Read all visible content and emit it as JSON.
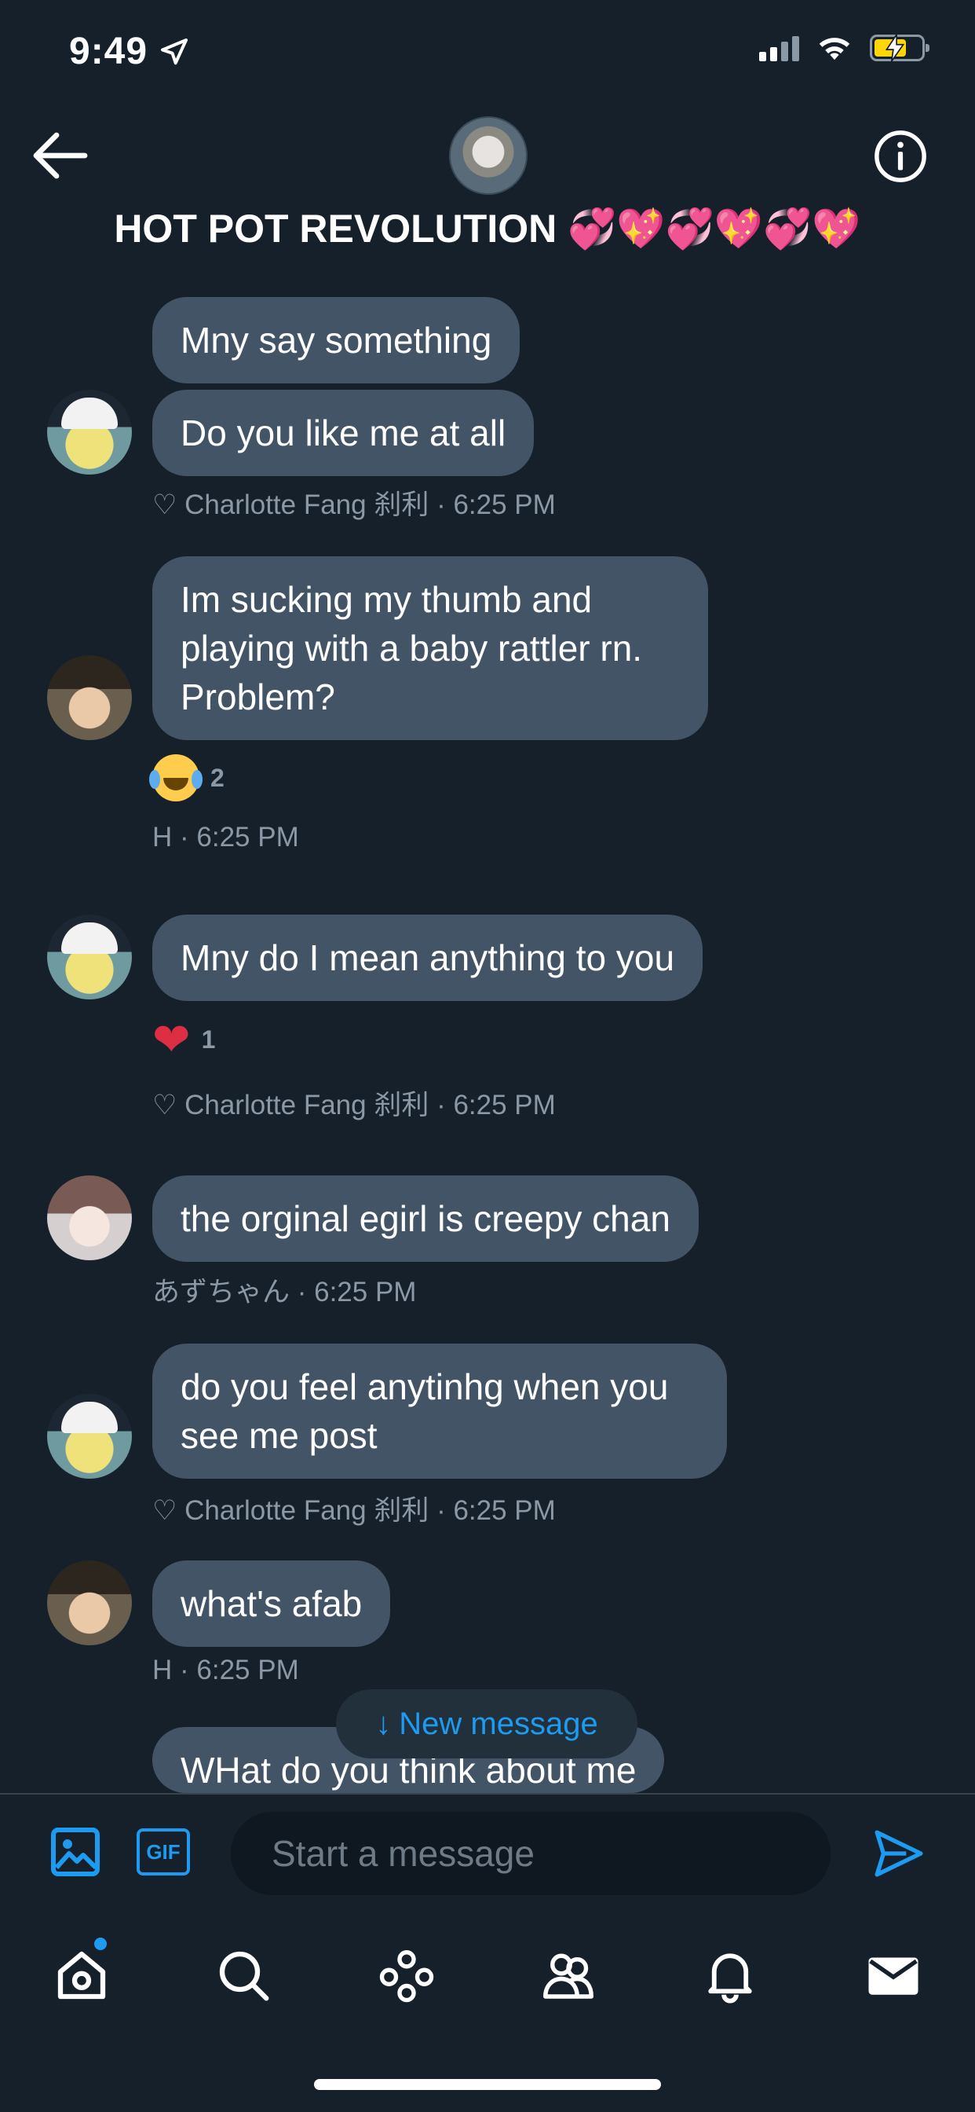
{
  "status_bar": {
    "time": "9:49"
  },
  "header": {
    "title": "HOT POT REVOLUTION 💞💖💞💖💞💖"
  },
  "messages": [
    {
      "text": "Mny say something"
    },
    {
      "text": "Do you like me at all",
      "meta": "♡ Charlotte Fang 刹利 · 6:25 PM"
    },
    {
      "text": "Im sucking my thumb and playing with a baby rattler rn. Problem?",
      "reaction": {
        "emoji": "😂",
        "count": "2"
      },
      "meta": "H · 6:25 PM"
    },
    {
      "text": "Mny do I mean anything to you",
      "reaction": {
        "emoji": "❤",
        "count": "1"
      },
      "meta": "♡ Charlotte Fang 刹利 · 6:25 PM"
    },
    {
      "text": "the orginal egirl is creepy chan",
      "meta": "あずちゃん · 6:25 PM"
    },
    {
      "text": "do you feel anytinhg when you see me post",
      "meta": "♡ Charlotte Fang 刹利 · 6:25 PM"
    },
    {
      "text": "what's afab",
      "meta": "H · 6:25 PM"
    },
    {
      "text": "WHat do you think about me"
    }
  ],
  "new_message_pill": {
    "arrow": "↓",
    "label": "New message"
  },
  "composer": {
    "gif_label": "GIF",
    "placeholder": "Start a message"
  },
  "colors": {
    "background": "#15202b",
    "bubble": "#425466",
    "accent": "#1d9bf0",
    "meta_text": "#8b98a5"
  },
  "icons": [
    "location-arrow-icon",
    "signal-icon",
    "wifi-icon",
    "battery-charging-icon",
    "back-arrow-icon",
    "info-icon",
    "image-icon",
    "gif-icon",
    "send-icon",
    "home-icon",
    "search-icon",
    "spaces-icon",
    "communities-icon",
    "bell-icon",
    "mail-icon"
  ]
}
